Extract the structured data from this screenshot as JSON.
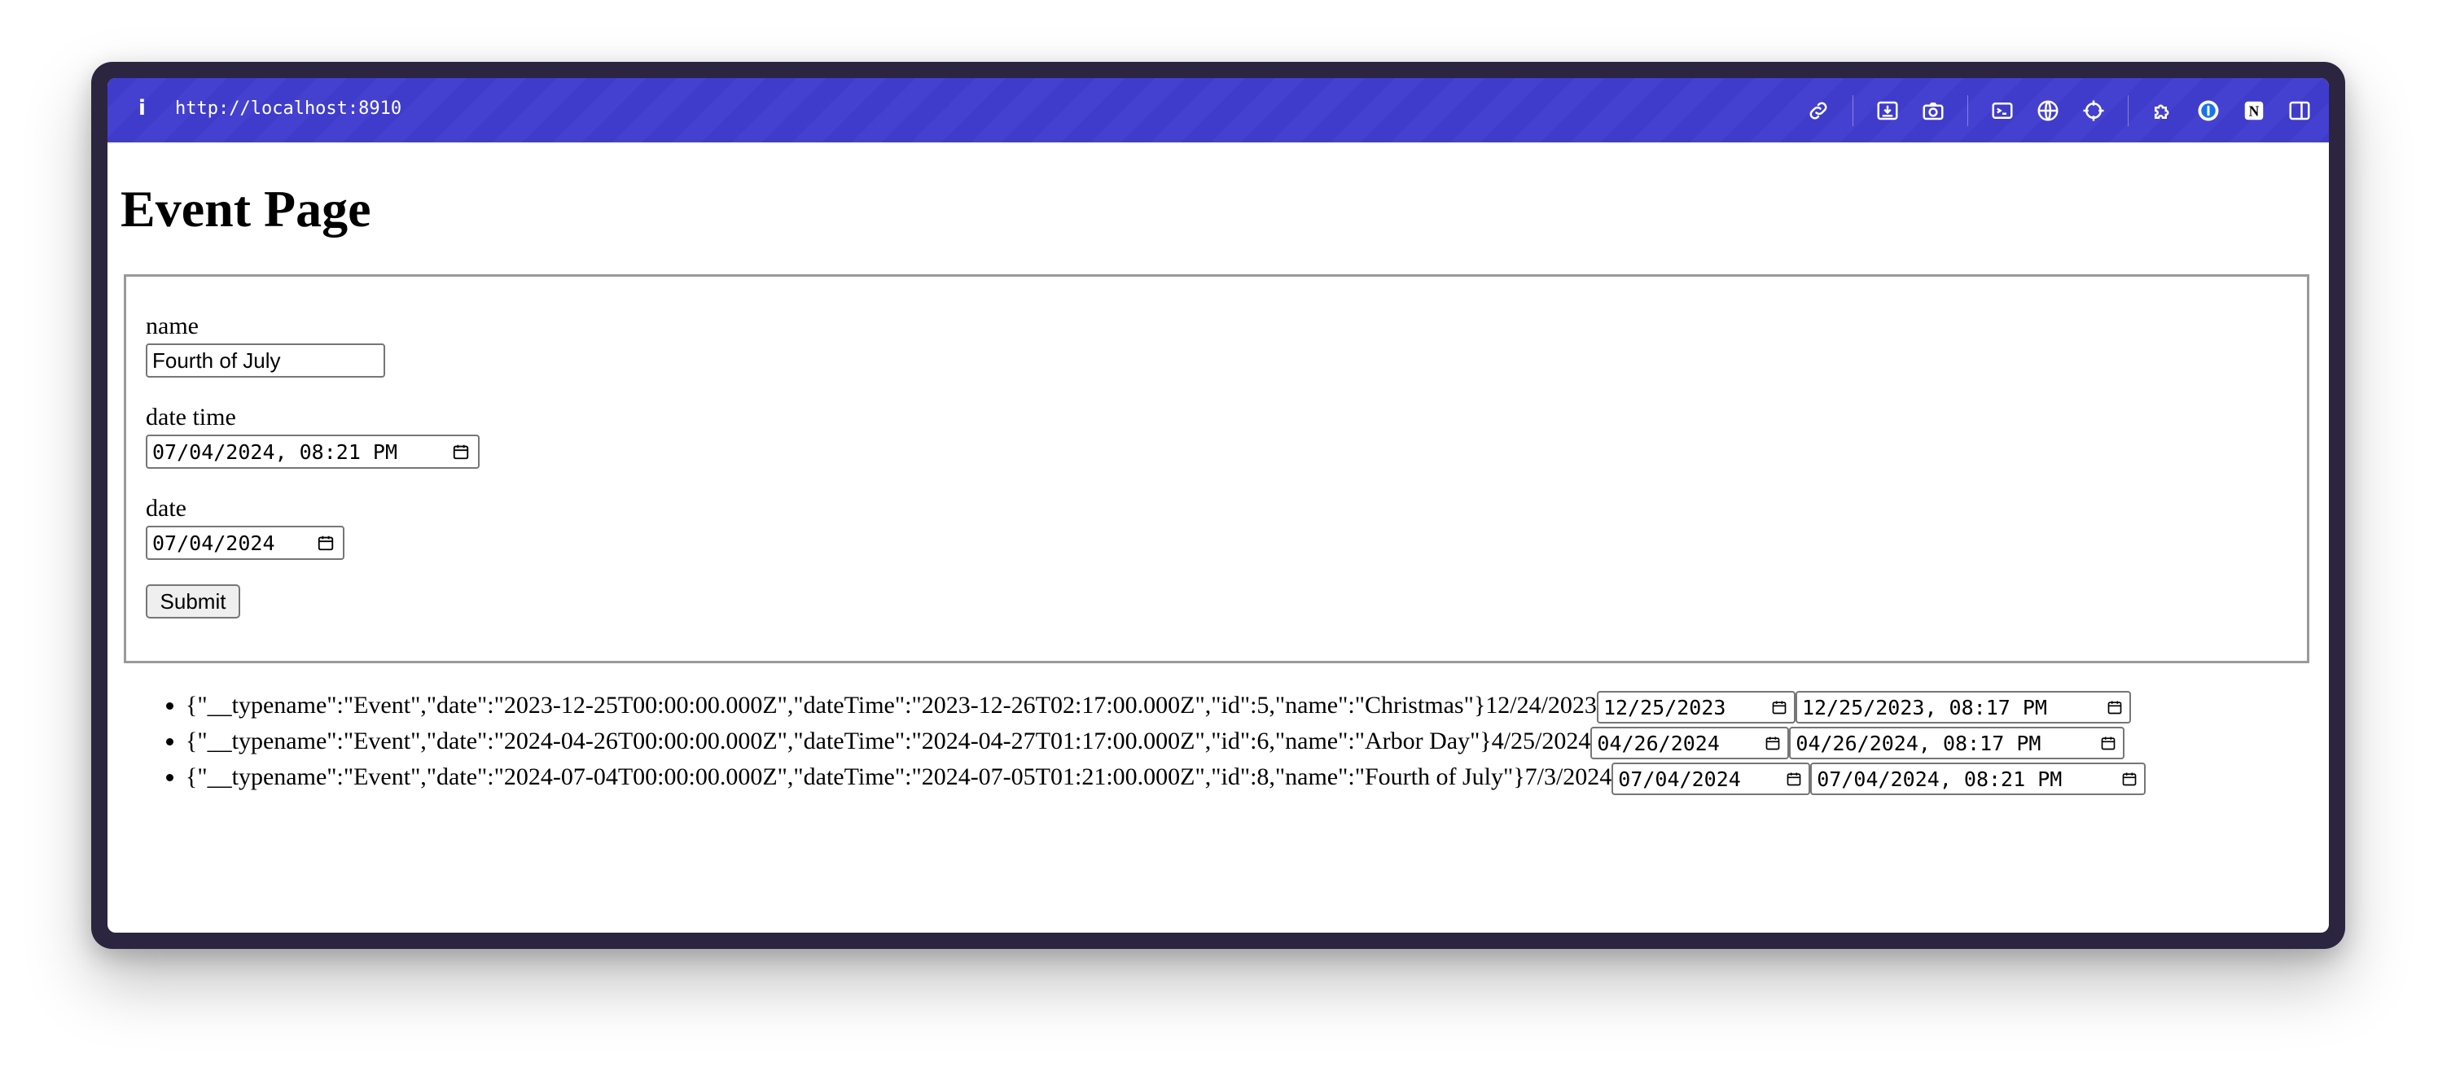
{
  "browser": {
    "url": "http://localhost:8910",
    "icons": [
      "info-icon",
      "link-icon",
      "download-icon",
      "camera-icon",
      "terminal-icon",
      "globe-icon",
      "crosshair-icon",
      "extension-icon",
      "password-manager-icon",
      "notion-icon",
      "sidebar-icon"
    ],
    "toolbar_color": "#3f3ccb"
  },
  "page": {
    "title": "Event Page"
  },
  "form": {
    "name_label": "name",
    "name_value": "Fourth of July",
    "datetime_label": "date time",
    "datetime_value": "07/04/2024, 08:21 PM",
    "date_label": "date",
    "date_value": "07/04/2024",
    "submit_label": "Submit"
  },
  "events": [
    {
      "json": "{\"__typename\":\"Event\",\"date\":\"2023-12-25T00:00:00.000Z\",\"dateTime\":\"2023-12-26T02:17:00.000Z\",\"id\":5,\"name\":\"Christmas\"}",
      "local_date": "12/24/2023",
      "date_input": "12/25/2023",
      "datetime_input": "12/25/2023, 08:17 PM"
    },
    {
      "json": "{\"__typename\":\"Event\",\"date\":\"2024-04-26T00:00:00.000Z\",\"dateTime\":\"2024-04-27T01:17:00.000Z\",\"id\":6,\"name\":\"Arbor Day\"}",
      "local_date": "4/25/2024",
      "date_input": "04/26/2024",
      "datetime_input": "04/26/2024, 08:17 PM"
    },
    {
      "json": "{\"__typename\":\"Event\",\"date\":\"2024-07-04T00:00:00.000Z\",\"dateTime\":\"2024-07-05T01:21:00.000Z\",\"id\":8,\"name\":\"Fourth of July\"}",
      "local_date": "7/3/2024",
      "date_input": "07/04/2024",
      "datetime_input": "07/04/2024, 08:21 PM"
    }
  ]
}
